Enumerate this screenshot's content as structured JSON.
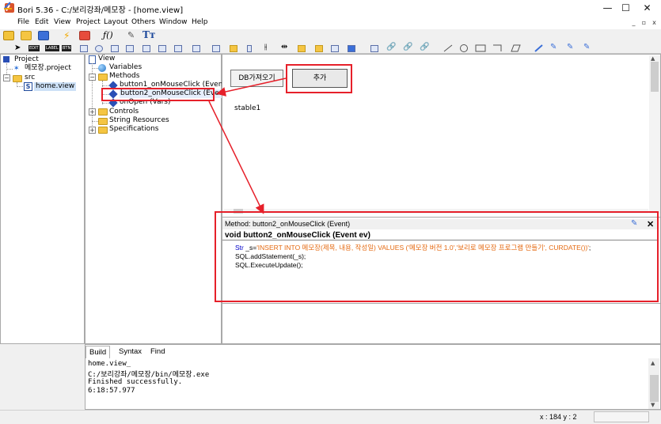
{
  "window": {
    "title": "Bori 5.36 - C:/보리강좌/메모장 - [home.view]",
    "minimize": "—",
    "maximize": "☐",
    "close": "✕"
  },
  "menu": {
    "items": [
      "File",
      "Edit",
      "View",
      "Project",
      "Layout",
      "Others",
      "Window",
      "Help"
    ],
    "mdi": [
      "_",
      "▫",
      "x"
    ]
  },
  "toolbar2": {
    "labels": [
      "EDIT",
      "LABEL",
      "BTN"
    ]
  },
  "project_tree": {
    "root": "Project",
    "project_file": "메모장.project",
    "src": "src",
    "home_view": "home.view"
  },
  "view_tree": {
    "root": "View",
    "variables": "Variables",
    "methods": "Methods",
    "method1": "button1_onMouseClick (Event)",
    "method2": "button2_onMouseClick (Event)",
    "method3": "onOpen (Vars)",
    "controls": "Controls",
    "string_resources": "String Resources",
    "specifications": "Specifications"
  },
  "design": {
    "button_db": "DB가져오기",
    "button_add": "추가",
    "stable": "stable1"
  },
  "code": {
    "header": "Method: button2_onMouseClick (Event)",
    "signature": "void button2_onMouseClick (Event ev)",
    "line1_kw": "Str",
    "line1_var": " _s=",
    "line1_str": "'INSERT INTO 메모장(제목, 내용, 작성일)  VALUES ('메모장 버전 1.0','보리로 메모장 프로그램 만들기', CURDATE())'",
    "line1_end": ";",
    "line2": "SQL.addStatement(_s);",
    "line3": "SQL.ExecuteUpdate();"
  },
  "build": {
    "tabs": [
      "Build",
      "Syntax",
      "Find"
    ],
    "output": [
      "home.view_",
      "C:/보리강좌/메모장/bin/메모장.exe",
      "Finished successfully.",
      "6:18:57.977"
    ]
  },
  "status": {
    "coords": "x : 184  y : 2"
  },
  "colors": {
    "annotation": "#e6202a",
    "keyword": "#0000c8",
    "string": "#e56a12"
  }
}
